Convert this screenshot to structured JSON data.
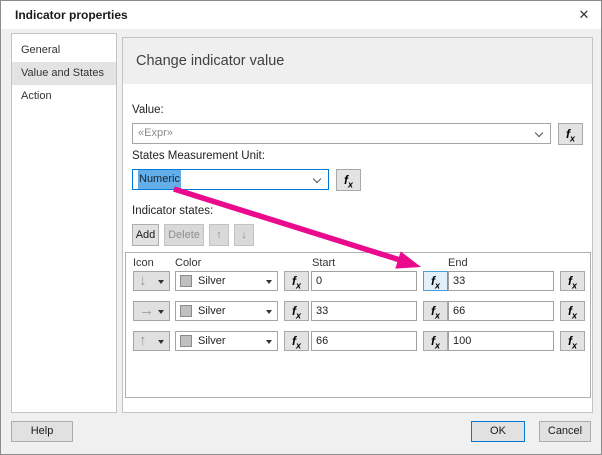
{
  "window": {
    "title": "Indicator properties",
    "close_glyph": "✕"
  },
  "sidebar": {
    "items": [
      {
        "label": "General"
      },
      {
        "label": "Value and States"
      },
      {
        "label": "Action"
      }
    ],
    "selected": "Value and States"
  },
  "main": {
    "heading": "Change indicator value",
    "value": {
      "label": "Value:",
      "current": "«Expr»"
    },
    "unit": {
      "label": "States Measurement Unit:",
      "current": "Numeric"
    },
    "states": {
      "label": "Indicator states:",
      "add_label": "Add",
      "delete_label": "Delete",
      "table": {
        "headers": {
          "icon": "Icon",
          "color": "Color",
          "start": "Start",
          "end": "End"
        },
        "rows": [
          {
            "icon": "down-arrow",
            "glyph": "↓",
            "color": "Silver",
            "start": "0",
            "end": "33"
          },
          {
            "icon": "right-arrow",
            "glyph": "→",
            "color": "Silver",
            "start": "33",
            "end": "66"
          },
          {
            "icon": "up-arrow",
            "glyph": "↑",
            "color": "Silver",
            "start": "66",
            "end": "100"
          }
        ]
      }
    }
  },
  "footer": {
    "help": "Help",
    "ok": "OK",
    "cancel": "Cancel"
  },
  "icons": {
    "fx_f": "f",
    "fx_x": "x",
    "move_up": "↑",
    "move_down": "↓"
  },
  "colors": {
    "accent_blue": "#0078d7",
    "annotation_magenta": "#ea0a8e",
    "silver_swatch": "#c0c0c0",
    "selection_blue": "#63ade8"
  }
}
